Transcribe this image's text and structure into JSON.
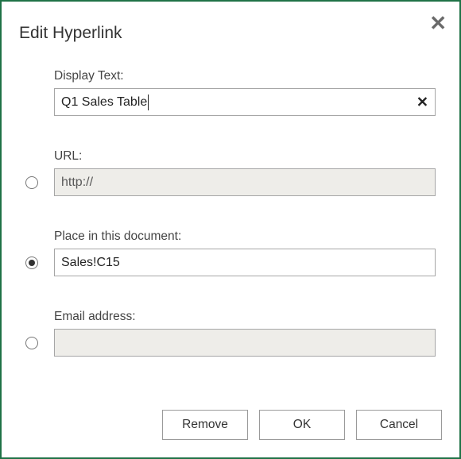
{
  "dialog": {
    "title": "Edit Hyperlink",
    "display_text_label": "Display Text:",
    "display_text_value": "Q1 Sales Table",
    "url_label": "URL:",
    "url_value": "http://",
    "place_label": "Place in this document:",
    "place_value": "Sales!C15",
    "email_label": "Email address:",
    "email_value": "",
    "selected_option": "place",
    "buttons": {
      "remove": "Remove",
      "ok": "OK",
      "cancel": "Cancel"
    }
  }
}
